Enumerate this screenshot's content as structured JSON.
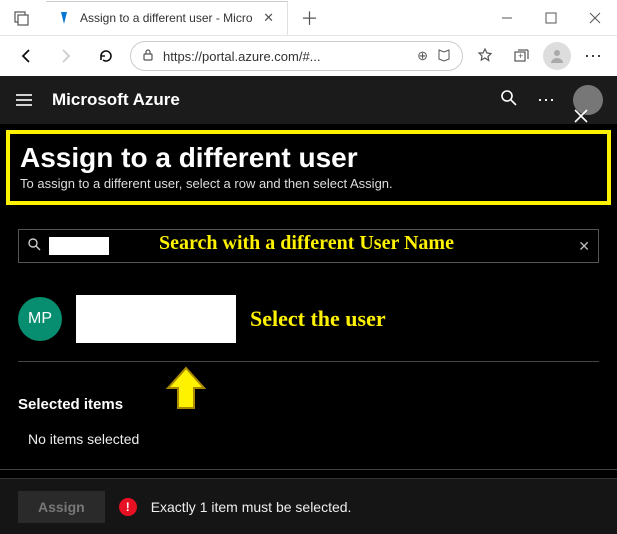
{
  "browser": {
    "tab_title": "Assign to a different user - Micro",
    "url": "https://portal.azure.com/#..."
  },
  "azure_header": {
    "brand": "Microsoft Azure"
  },
  "panel": {
    "title": "Assign to a different user",
    "subtitle": "To assign to a different user, select a row and then select Assign."
  },
  "annotations": {
    "search": "Search with a different User Name",
    "user": "Select the user"
  },
  "user": {
    "avatar_initials": "MP"
  },
  "selected": {
    "heading": "Selected items",
    "empty": "No items selected"
  },
  "footer": {
    "assign_label": "Assign",
    "error_text": "Exactly 1 item must be selected."
  }
}
